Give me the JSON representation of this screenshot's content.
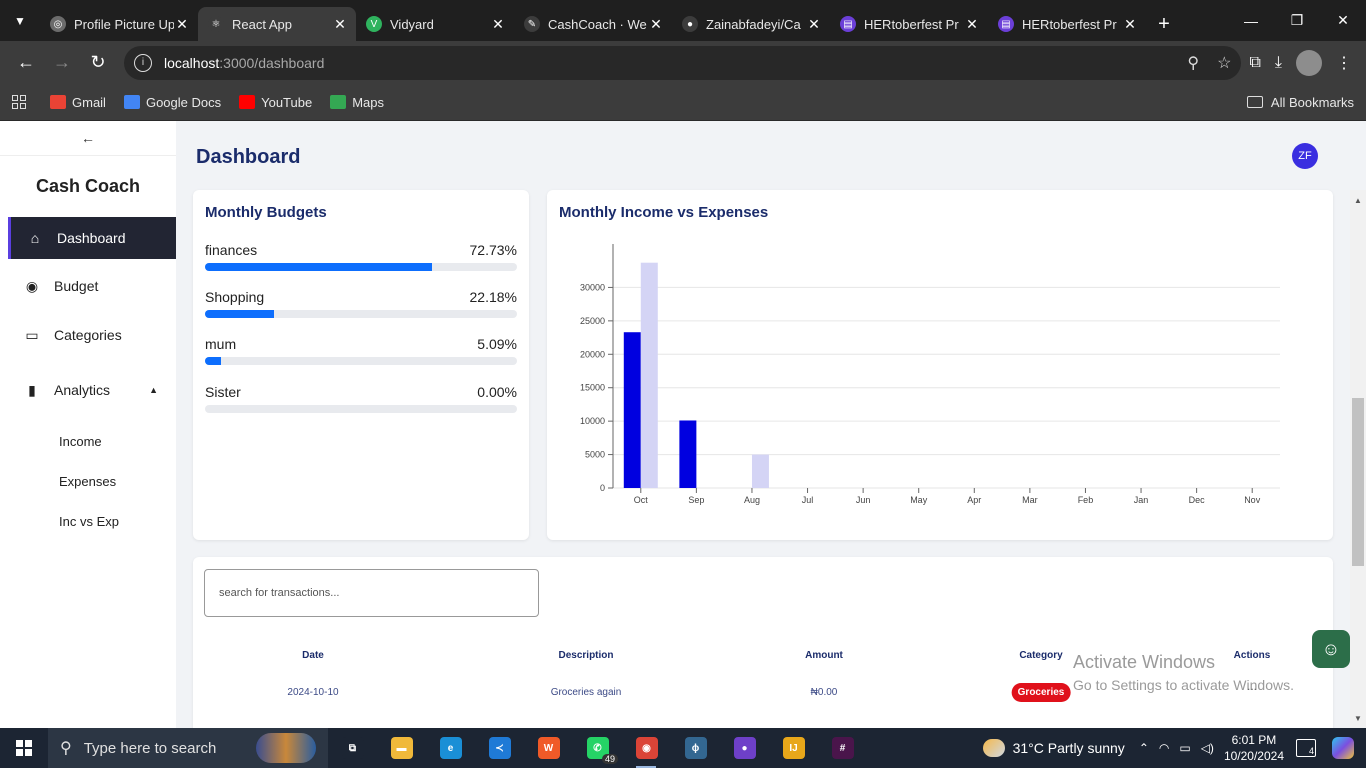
{
  "browser": {
    "tabs": [
      {
        "label": "Profile Picture Up",
        "color": "#6b6b6b",
        "glyph": "◎"
      },
      {
        "label": "React App",
        "color": "#3c3c3c",
        "glyph": "⚛",
        "active": true
      },
      {
        "label": "Vidyard",
        "color": "#2fb35e",
        "glyph": "V"
      },
      {
        "label": "CashCoach · We",
        "color": "#3c3c3c",
        "glyph": "✎"
      },
      {
        "label": "Zainabfadeyi/Ca",
        "color": "#3c3c3c",
        "glyph": "●"
      },
      {
        "label": "HERtoberfest Pr",
        "color": "#6b3fd8",
        "glyph": "▤"
      },
      {
        "label": "HERtoberfest Pr",
        "color": "#6b3fd8",
        "glyph": "▤"
      }
    ],
    "url_host": "localhost",
    "url_path": ":3000/dashboard",
    "bookmarks": [
      {
        "label": "Gmail",
        "color": "#ea4335"
      },
      {
        "label": "Google Docs",
        "color": "#4285f4"
      },
      {
        "label": "YouTube",
        "color": "#ff0000"
      },
      {
        "label": "Maps",
        "color": "#34a853"
      }
    ],
    "all_bookmarks": "All Bookmarks"
  },
  "sidebar": {
    "back_glyph": "←",
    "brand": "Cash Coach",
    "items": [
      {
        "label": "Dashboard",
        "icon": "home-icon",
        "glyph": "⌂"
      },
      {
        "label": "Budget",
        "icon": "wallet-icon",
        "glyph": "◉"
      },
      {
        "label": "Categories",
        "icon": "inbox-icon",
        "glyph": "▭"
      },
      {
        "label": "Analytics",
        "icon": "bar-chart-icon",
        "glyph": "▮"
      }
    ],
    "analytics_sub": [
      "Income",
      "Expenses",
      "Inc vs Exp"
    ]
  },
  "header": {
    "title": "Dashboard",
    "avatar_initials": "ZF"
  },
  "budgets": {
    "title": "Monthly Budgets",
    "items": [
      {
        "name": "finances",
        "percent_label": "72.73%",
        "value": 72.73
      },
      {
        "name": "Shopping",
        "percent_label": "22.18%",
        "value": 22.18
      },
      {
        "name": "mum",
        "percent_label": "5.09%",
        "value": 5.09
      },
      {
        "name": "Sister",
        "percent_label": "0.00%",
        "value": 0
      }
    ]
  },
  "income_chart": {
    "title": "Monthly Income vs Expenses"
  },
  "chart_data": {
    "type": "bar",
    "title": "Monthly Income vs Expenses",
    "categories": [
      "Oct",
      "Sep",
      "Aug",
      "Jul",
      "Jun",
      "May",
      "Apr",
      "Mar",
      "Feb",
      "Jan",
      "Dec",
      "Nov"
    ],
    "series": [
      {
        "color": "#0000e0",
        "values": [
          23300,
          10100,
          0,
          0,
          0,
          0,
          0,
          0,
          0,
          0,
          0,
          0
        ]
      },
      {
        "color": "#d4d4f5",
        "values": [
          33700,
          0,
          5000,
          0,
          0,
          0,
          0,
          0,
          0,
          0,
          0,
          0
        ]
      }
    ],
    "yticks": [
      0,
      5000,
      10000,
      15000,
      20000,
      25000,
      30000
    ],
    "ylim": [
      0,
      35000
    ],
    "grid": true
  },
  "transactions": {
    "search_placeholder": "search for transactions...",
    "columns": [
      "Date",
      "Description",
      "Amount",
      "Category",
      "Actions"
    ],
    "rows": [
      {
        "date": "2024-10-10",
        "description": "Groceries again",
        "amount": "₦0.00",
        "category": "Groceries",
        "actions": "..."
      }
    ]
  },
  "watermark": {
    "line1": "Activate Windows",
    "line2": "Go to Settings to activate Windows."
  },
  "taskbar": {
    "search_placeholder": "Type here to search",
    "whatsapp_badge": "49",
    "weather": "31°C  Partly sunny",
    "time": "6:01 PM",
    "date": "10/20/2024",
    "notifications": "4",
    "apps": [
      {
        "name": "task-view",
        "color": "#1c2533",
        "glyph": "⧉"
      },
      {
        "name": "file-explorer",
        "color": "#f0b93a",
        "glyph": "▬"
      },
      {
        "name": "edge",
        "color": "#1a8fd6",
        "glyph": "e"
      },
      {
        "name": "vscode",
        "color": "#1f7ad6",
        "glyph": "≺"
      },
      {
        "name": "brave",
        "color": "#f05a28",
        "glyph": "W"
      },
      {
        "name": "whatsapp",
        "color": "#25d366",
        "glyph": "✆"
      },
      {
        "name": "chrome",
        "color": "#db4437",
        "glyph": "◉"
      },
      {
        "name": "postgres",
        "color": "#336791",
        "glyph": "ϕ"
      },
      {
        "name": "github-desktop",
        "color": "#6e40c9",
        "glyph": "●"
      },
      {
        "name": "jetbrains",
        "color": "#e8a71a",
        "glyph": "IJ"
      },
      {
        "name": "slack",
        "color": "#4a154b",
        "glyph": "#"
      }
    ]
  }
}
